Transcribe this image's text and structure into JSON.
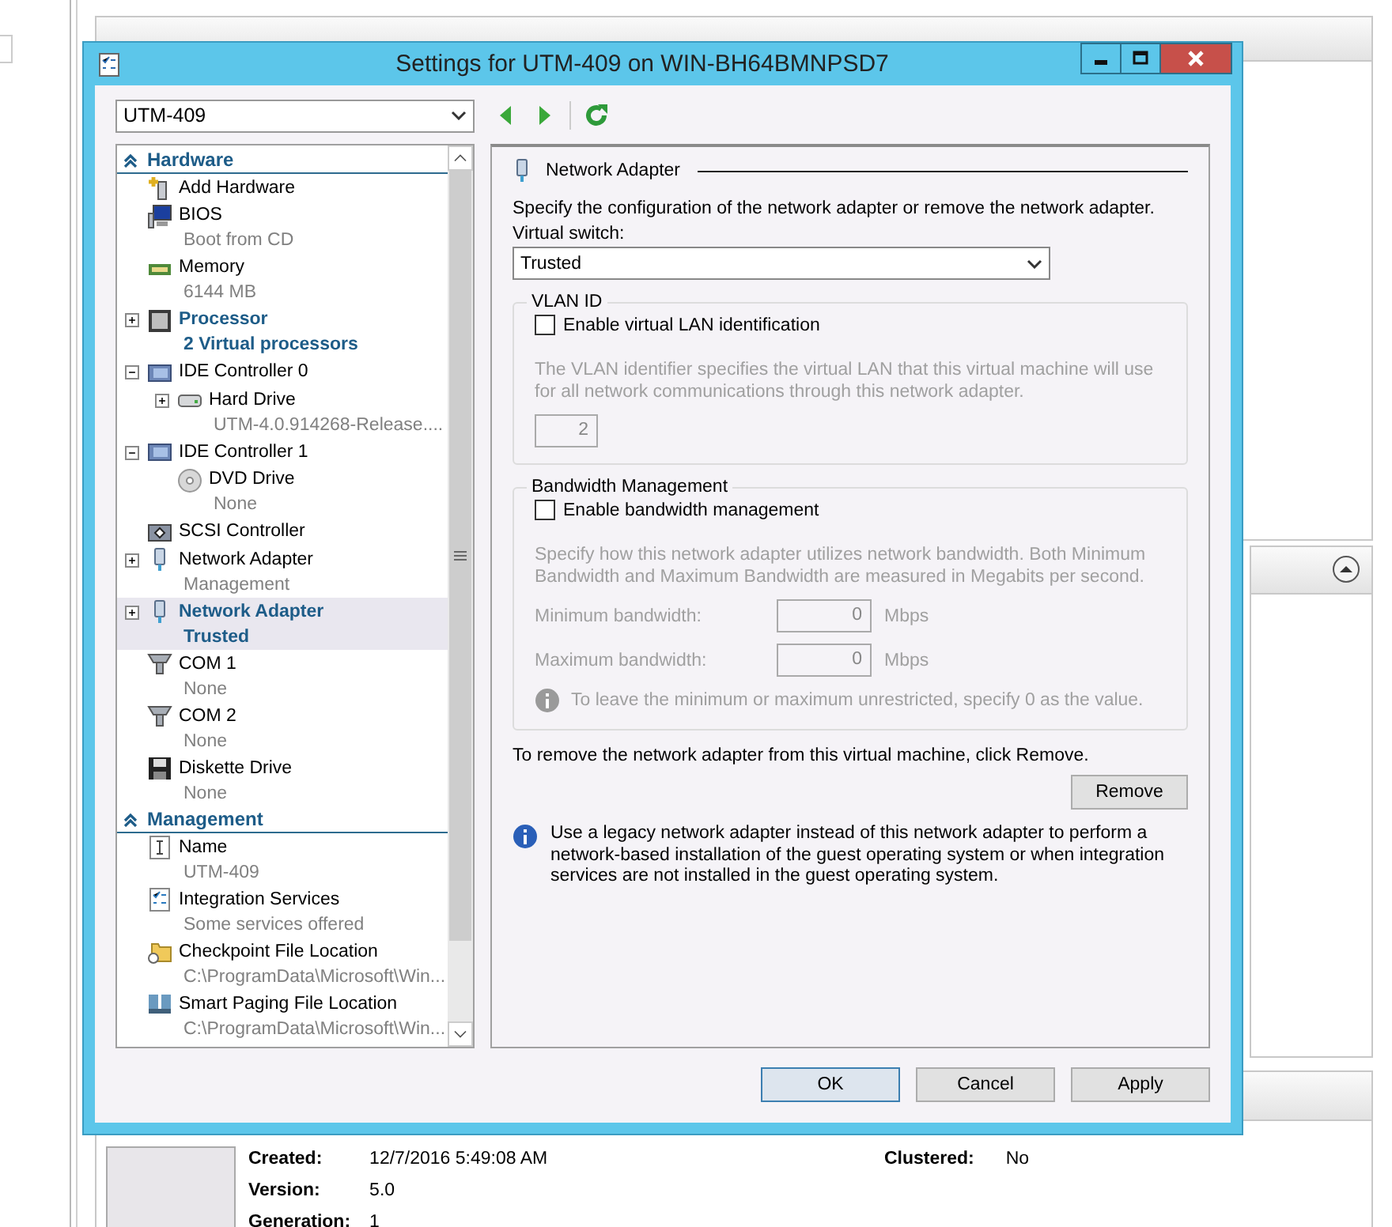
{
  "background": {
    "details": [
      {
        "label": "Created:",
        "value": "12/7/2016 5:49:08 AM"
      },
      {
        "label": "Version:",
        "value": "5.0"
      },
      {
        "label": "Generation:",
        "value": "1"
      }
    ],
    "details_right": [
      {
        "label": "Clustered:",
        "value": "No"
      }
    ]
  },
  "dialog": {
    "title": "Settings for UTM-409 on WIN-BH64BMNPSD7",
    "vm_select": "UTM-409",
    "tree": [
      {
        "title": "Hardware",
        "items": [
          {
            "kind": "add",
            "label": "Add Hardware",
            "selected": false,
            "emphasized": false
          },
          {
            "kind": "bios",
            "label": "BIOS",
            "sub": "Boot from CD",
            "selected": false,
            "emphasized": false
          },
          {
            "kind": "memory",
            "label": "Memory",
            "sub": "6144 MB",
            "selected": false,
            "emphasized": false
          },
          {
            "kind": "cpu",
            "label": "Processor",
            "sub": "2 Virtual processors",
            "expanded": false,
            "selected": false,
            "emphasized": true
          },
          {
            "kind": "controller",
            "label": "IDE Controller 0",
            "expanded": true,
            "selected": false,
            "emphasized": false,
            "children": [
              {
                "kind": "disk",
                "label": "Hard Drive",
                "sub": "UTM-4.0.914268-Release....",
                "expanded": false,
                "selected": false,
                "emphasized": false
              }
            ]
          },
          {
            "kind": "controller",
            "label": "IDE Controller 1",
            "expanded": true,
            "selected": false,
            "emphasized": false,
            "children": [
              {
                "kind": "dvd",
                "label": "DVD Drive",
                "sub": "None",
                "selected": false,
                "emphasized": false
              }
            ]
          },
          {
            "kind": "scsi",
            "label": "SCSI Controller",
            "selected": false,
            "emphasized": false
          },
          {
            "kind": "nic",
            "label": "Network Adapter",
            "sub": "Management",
            "expanded": false,
            "selected": false,
            "emphasized": false
          },
          {
            "kind": "nic",
            "label": "Network Adapter",
            "sub": "Trusted",
            "expanded": false,
            "selected": true,
            "emphasized": true
          },
          {
            "kind": "com",
            "label": "COM 1",
            "sub": "None",
            "selected": false,
            "emphasized": false
          },
          {
            "kind": "com",
            "label": "COM 2",
            "sub": "None",
            "selected": false,
            "emphasized": false
          },
          {
            "kind": "floppy",
            "label": "Diskette Drive",
            "sub": "None",
            "selected": false,
            "emphasized": false
          }
        ]
      },
      {
        "title": "Management",
        "items": [
          {
            "kind": "name",
            "label": "Name",
            "sub": "UTM-409",
            "selected": false,
            "emphasized": false
          },
          {
            "kind": "services",
            "label": "Integration Services",
            "sub": "Some services offered",
            "selected": false,
            "emphasized": false
          },
          {
            "kind": "folder",
            "label": "Checkpoint File Location",
            "sub": "C:\\ProgramData\\Microsoft\\Win...",
            "selected": false,
            "emphasized": false
          },
          {
            "kind": "paging",
            "label": "Smart Paging File Location",
            "sub": "C:\\ProgramData\\Microsoft\\Win...",
            "selected": false,
            "emphasized": false
          }
        ]
      }
    ],
    "panel": {
      "heading": "Network Adapter",
      "description": "Specify the configuration of the network adapter or remove the network adapter.",
      "switch_label": "Virtual switch:",
      "switch_value": "Trusted",
      "vlan": {
        "legend": "VLAN ID",
        "checkbox": {
          "label": "Enable virtual LAN identification",
          "checked": false
        },
        "note": "The VLAN identifier specifies the virtual LAN that this virtual machine will use for all network communications through this network adapter.",
        "value": "2"
      },
      "bandwidth": {
        "legend": "Bandwidth Management",
        "checkbox": {
          "label": "Enable bandwidth management",
          "checked": false
        },
        "note": "Specify how this network adapter utilizes network bandwidth. Both Minimum Bandwidth and Maximum Bandwidth are measured in Megabits per second.",
        "fields": [
          {
            "label": "Minimum bandwidth:",
            "value": "0",
            "unit": "Mbps"
          },
          {
            "label": "Maximum bandwidth:",
            "value": "0",
            "unit": "Mbps"
          }
        ],
        "hint": "To leave the minimum or maximum unrestricted, specify 0 as the value."
      },
      "remove_text": "To remove the network adapter from this virtual machine, click Remove.",
      "remove_button": "Remove",
      "legacy_note": "Use a legacy network adapter instead of this network adapter to perform a network-based installation of the guest operating system or when integration services are not installed in the guest operating system."
    },
    "buttons": [
      {
        "label": "OK",
        "default": true
      },
      {
        "label": "Cancel",
        "default": false
      },
      {
        "label": "Apply",
        "default": false
      }
    ]
  }
}
